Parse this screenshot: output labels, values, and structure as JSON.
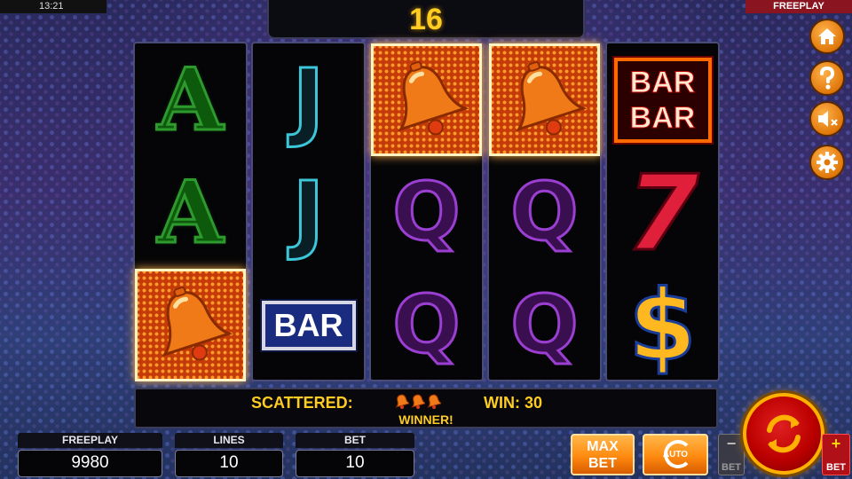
{
  "status": {
    "time": "13:21",
    "mode": "FREEPLAY"
  },
  "top_display": {
    "value": "16"
  },
  "reels": [
    [
      "A",
      "A",
      "BELL"
    ],
    [
      "J",
      "J",
      "BAR"
    ],
    [
      "BELL",
      "Q",
      "Q"
    ],
    [
      "BELL",
      "Q",
      "Q"
    ],
    [
      "BARBAR",
      "7",
      "$"
    ]
  ],
  "highlighted": [
    [
      0,
      2
    ],
    [
      2,
      0
    ],
    [
      3,
      0
    ]
  ],
  "symbols": {
    "bar_single": "BAR",
    "bar_double_line1": "BAR",
    "bar_double_line2": "BAR",
    "seven": "7",
    "dollar": "$"
  },
  "info_bar": {
    "scattered_label": "SCATTERED:",
    "win_text": "WIN: 30",
    "winner_text": "WINNER!"
  },
  "stats": {
    "freeplay_label": "FREEPLAY",
    "freeplay_value": "9980",
    "lines_label": "LINES",
    "lines_value": "10",
    "bet_label": "BET",
    "bet_value": "10"
  },
  "buttons": {
    "maxbet_line1": "MAX",
    "maxbet_line2": "BET",
    "auto_label": "AUTO",
    "bet_minus_sign": "−",
    "bet_minus_label": "BET",
    "bet_plus_sign": "+",
    "bet_plus_label": "BET"
  },
  "side_icons": [
    "home-icon",
    "help-icon",
    "sound-muted-icon",
    "settings-icon"
  ],
  "colors": {
    "accent": "#ffcc22",
    "spin": "#b00000",
    "orange": "#ff8a10"
  }
}
